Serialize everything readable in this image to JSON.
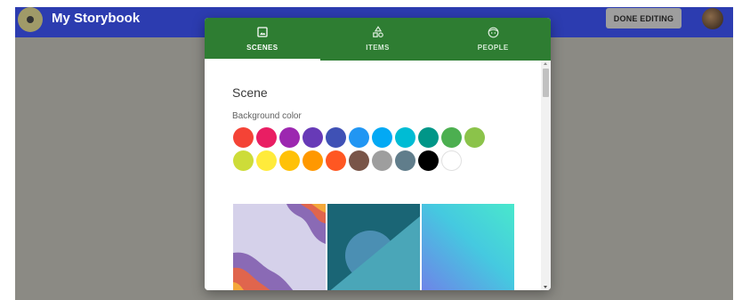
{
  "app": {
    "title": "My Storybook",
    "done_label": "DONE EDITING"
  },
  "tabs": [
    {
      "label": "SCENES",
      "icon": "image-icon",
      "active": true
    },
    {
      "label": "ITEMS",
      "icon": "shapes-icon",
      "active": false
    },
    {
      "label": "PEOPLE",
      "icon": "face-icon",
      "active": false
    }
  ],
  "scene": {
    "heading": "Scene",
    "bg_label": "Background color",
    "colors": [
      [
        "#f44336",
        "#e91e63",
        "#9c27b0",
        "#673ab7",
        "#3f51b5",
        "#2196f3",
        "#03a9f4",
        "#00bcd4",
        "#009688",
        "#4caf50",
        "#8bc34a"
      ],
      [
        "#cddc39",
        "#ffeb3b",
        "#ffc107",
        "#ff9800",
        "#ff5722",
        "#795548",
        "#9e9e9e",
        "#607d8b",
        "#000000",
        "#ffffff"
      ]
    ]
  },
  "theme": {
    "app_bar": "#2c3cb0",
    "tab_bar": "#2e7d32",
    "backdrop": "#8b8a84"
  }
}
